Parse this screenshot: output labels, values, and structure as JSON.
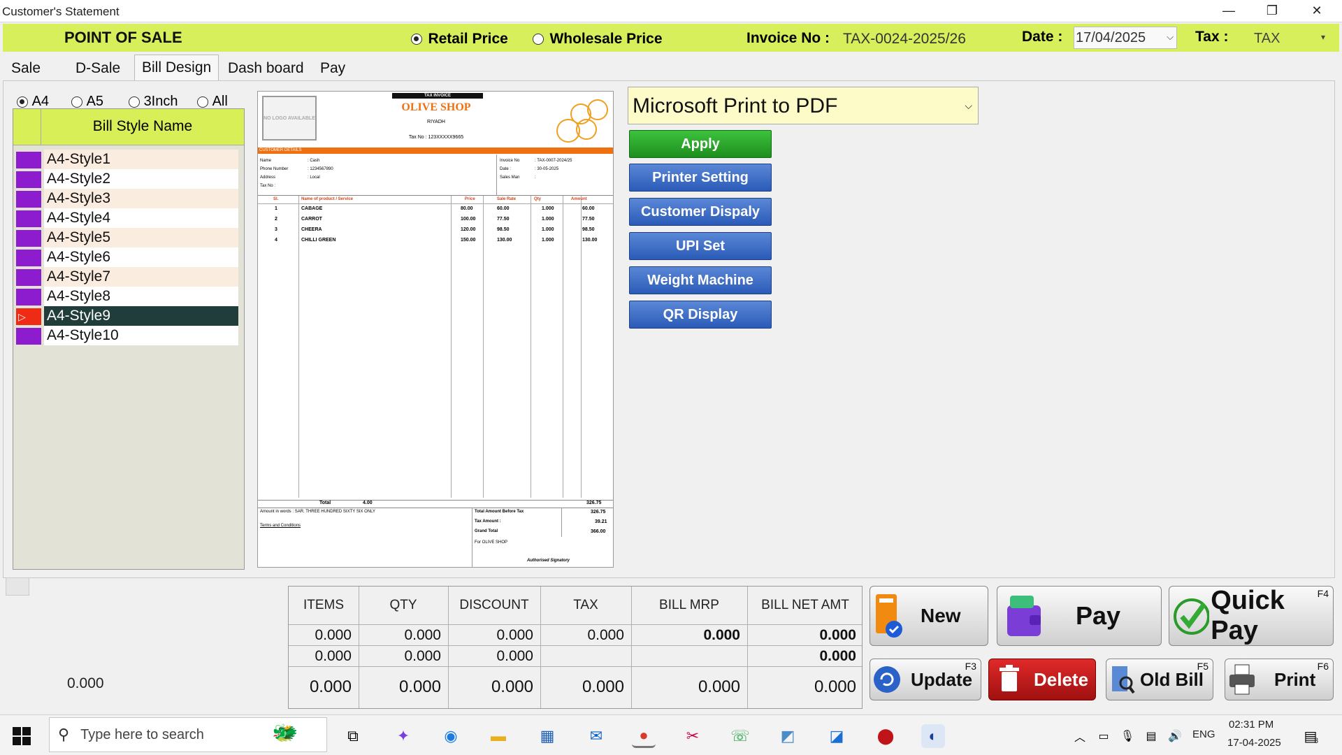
{
  "window": {
    "title": "Customer's Statement",
    "minimize": "—",
    "restore": "❐",
    "close": "✕"
  },
  "header": {
    "app_title": "POINT OF SALE",
    "retail_price": "Retail Price",
    "wholesale_price": "Wholesale Price",
    "invoice_label": "Invoice No :",
    "invoice_value": "TAX-0024-2025/26",
    "date_label": "Date :",
    "date_value": "17/04/2025",
    "tax_label": "Tax :",
    "tax_value": "TAX"
  },
  "tabs": [
    "Sale",
    "D-Sale",
    "Bill Design",
    "Dash board",
    "Pay"
  ],
  "paper_sizes": [
    "A4",
    "A5",
    "3Inch",
    "All"
  ],
  "style_list": {
    "header": "Bill Style Name",
    "items": [
      "A4-Style1",
      "A4-Style2",
      "A4-Style3",
      "A4-Style4",
      "A4-Style5",
      "A4-Style6",
      "A4-Style7",
      "A4-Style8",
      "A4-Style9",
      "A4-Style10"
    ],
    "selected": "A4-Style9"
  },
  "invoice_preview": {
    "tag": "TAX INVOICE",
    "logo_text": "NO LOGO AVAILABLE",
    "shop_name": "OLIVE SHOP",
    "city": "RIYADH",
    "tax_no": "Tax No : 123XXXXX9665",
    "customer_bar": "CUSTOMER DETAILS",
    "cust_labels": [
      "Name",
      "Phone Number",
      "Address",
      "Tax No :"
    ],
    "cust_values": [
      ": Cash",
      ": 1234567890",
      ": Local",
      ""
    ],
    "inv_labels": [
      "Invoice No",
      "Date :",
      "Sales Man"
    ],
    "inv_values": [
      ": TAX-0007-2024/25",
      ": 30-05-2025",
      ":"
    ],
    "col_heads": [
      "Sl.",
      "Name of product / Service",
      "Price",
      "Sale Rate",
      "Qty",
      "Amount"
    ],
    "rows": [
      [
        "1",
        "CABAGE",
        "80.00",
        "60.00",
        "1.000",
        "60.00"
      ],
      [
        "2",
        "CARROT",
        "100.00",
        "77.50",
        "1.000",
        "77.50"
      ],
      [
        "3",
        "CHEERA",
        "120.00",
        "98.50",
        "1.000",
        "98.50"
      ],
      [
        "4",
        "CHILLI GREEN",
        "150.00",
        "130.00",
        "1.000",
        "130.00"
      ]
    ],
    "total_label": "Total",
    "total_qty": "4.00",
    "total_amt": "326.75",
    "amount_words": "Amount in words : SAR. THREE HUNDRED SIXTY SIX ONLY",
    "terms": "Terms and Conditions",
    "before_tax_label": "Total Amount Before Tax",
    "before_tax_value": "326.75",
    "tax_amount_label": "Tax Amount :",
    "tax_amount_value": "39.21",
    "grand_total_label": "Grand Total",
    "grand_total_value": "366.00",
    "for_shop": "For OLIVE SHOP",
    "signatory": "Authorised Signatory"
  },
  "printer": {
    "selected": "Microsoft Print to PDF"
  },
  "side_buttons": {
    "apply": "Apply",
    "printer_setting": "Printer Setting",
    "customer_display": "Customer Dispaly",
    "upi_set": "UPI Set",
    "weight_machine": "Weight Machine",
    "qr_display": "QR Display"
  },
  "summary": {
    "left_value": "0.000",
    "headers": [
      "ITEMS",
      "QTY",
      "DISCOUNT",
      "TAX",
      "BILL MRP",
      "BILL NET AMT"
    ],
    "row1": [
      "0.000",
      "0.000",
      "0.000",
      "0.000",
      "0.000",
      "0.000"
    ],
    "row2": [
      "0.000",
      "0.000",
      "0.000",
      "",
      "",
      "0.000"
    ],
    "row3": [
      "0.000",
      "0.000",
      "0.000",
      "0.000",
      "0.000",
      "0.000"
    ]
  },
  "action_buttons": {
    "new": "New",
    "pay": "Pay",
    "quick_pay": "Quick Pay",
    "quick_pay_key": "F4",
    "update": "Update",
    "update_key": "F3",
    "delete": "Delete",
    "old_bill": "Old Bill",
    "old_bill_key": "F5",
    "print": "Print",
    "print_key": "F6"
  },
  "taskbar": {
    "search_placeholder": "Type here to search",
    "lang": "ENG",
    "time": "02:31 PM",
    "date": "17-04-2025",
    "notif_count": "3"
  },
  "colors": {
    "header": "#d8ef5c",
    "apply": "#2aa52a",
    "blue_button": "#2a5bb7",
    "delete": "#c0141a",
    "swatch": "#8e1ccf",
    "selected_row": "#203d3c"
  }
}
